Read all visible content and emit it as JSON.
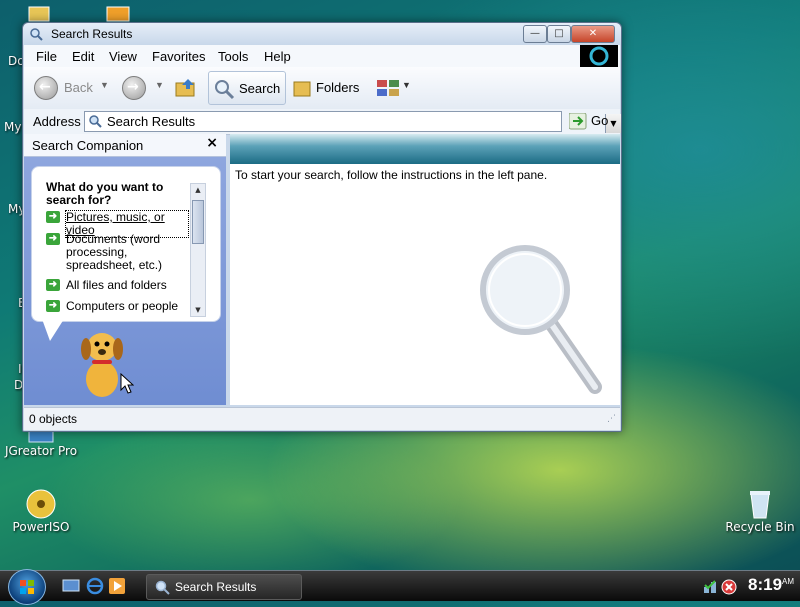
{
  "desktop": {
    "icons": [
      {
        "id": "jcreator",
        "label": "JGreator Pro"
      },
      {
        "id": "poweriso",
        "label": "PowerISO"
      },
      {
        "id": "recycle",
        "label": "Recycle Bin"
      }
    ],
    "fragments": [
      "Do",
      "My",
      "My",
      "E",
      "I",
      "D"
    ]
  },
  "window": {
    "title": "Search Results",
    "min_glyph": "—",
    "max_glyph": "□",
    "close_glyph": "✕"
  },
  "menubar": {
    "items": [
      "File",
      "Edit",
      "View",
      "Favorites",
      "Tools",
      "Help"
    ]
  },
  "toolbar": {
    "back": "Back",
    "search": "Search",
    "folders": "Folders"
  },
  "address": {
    "label": "Address",
    "value": "Search Results",
    "go": "Go"
  },
  "search_companion": {
    "title": "Search Companion",
    "close": "×",
    "question": "What do you want to search for?",
    "options": [
      "Pictures, music, or video",
      "Documents (word processing, spreadsheet, etc.)",
      "All files and folders",
      "Computers or people"
    ]
  },
  "results": {
    "instruction": "To start your search, follow the instructions in the left pane."
  },
  "status": {
    "text": "0 objects"
  },
  "taskbar": {
    "task_label": "Search Results",
    "clock_time": "8:19",
    "clock_ampm": "AM"
  },
  "colors": {
    "accent": "#1b6b84",
    "companion_bg": "#7e98d6",
    "option_arrow": "#3aa53a"
  }
}
